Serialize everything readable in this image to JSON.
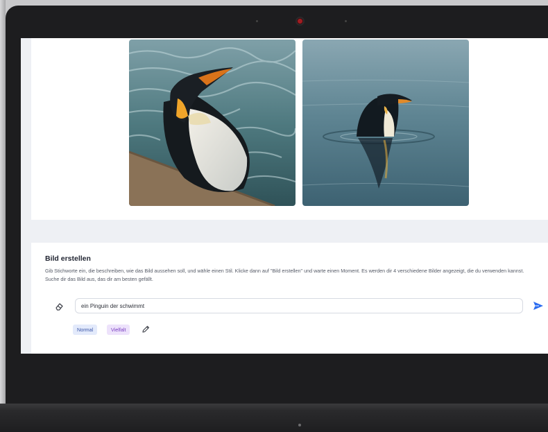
{
  "gallery": {
    "images": [
      {
        "name": "penguin-image-1",
        "subject": "king penguin in water"
      },
      {
        "name": "penguin-image-2",
        "subject": "penguin swimming in calm water"
      }
    ]
  },
  "create": {
    "title": "Bild erstellen",
    "description": "Gib Stichworte ein, die beschreiben, wie das Bild aussehen soll, und wähle einen Stil. Klicke dann auf \"Bild erstellen\" und warte einen Moment. Es werden dir 4 verschiedene Bilder angezeigt, die du verwenden kannst. Suche dir das Bild aus, das dir am besten gefällt.",
    "prompt_value": "ein Pinguin der schwimmt",
    "styles": [
      {
        "label": "Normal"
      },
      {
        "label": "Vielfalt"
      }
    ],
    "icons": {
      "clear": "eraser-icon",
      "send": "send-icon",
      "edit": "pencil-icon"
    }
  },
  "colors": {
    "accent": "#2b6cf0",
    "chip_normal_bg": "#e3eafb",
    "chip_vielfalt_bg": "#ede2fb"
  }
}
